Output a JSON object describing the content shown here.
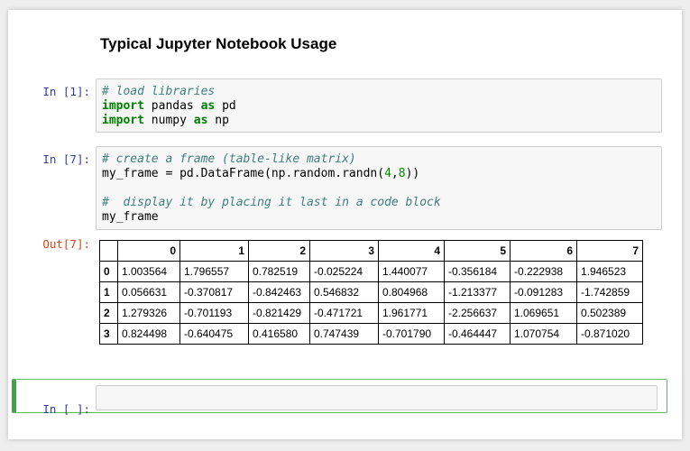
{
  "notebook": {
    "title": "Typical Jupyter Notebook Usage",
    "cells": [
      {
        "prompt": "In [1]:",
        "lines": [
          {
            "comment": "# load libraries"
          },
          {
            "kw1": "import",
            "mid": " pandas ",
            "kw2": "as",
            "end": " pd"
          },
          {
            "kw1": "import",
            "mid": " numpy ",
            "kw2": "as",
            "end": " np"
          }
        ]
      },
      {
        "prompt": "In [7]:",
        "line1_comment": "# create a frame (table-like matrix)",
        "line2_pre": "my_frame = pd.DataFrame(np.random.randn(",
        "line2_n1": "4",
        "line2_sep": ",",
        "line2_n2": "8",
        "line2_post": "))",
        "line4_comment": "#  display it by placing it last in a code block",
        "line5": "my_frame"
      }
    ],
    "output_prompt": "Out[7]:",
    "empty_prompt": "In [ ]:"
  },
  "dataframe": {
    "columns": [
      "",
      "0",
      "1",
      "2",
      "3",
      "4",
      "5",
      "6",
      "7"
    ],
    "rows": [
      {
        "index": "0",
        "values": [
          "1.003564",
          "1.796557",
          "0.782519",
          "-0.025224",
          "1.440077",
          "-0.356184",
          "-0.222938",
          "1.946523"
        ]
      },
      {
        "index": "1",
        "values": [
          "0.056631",
          "-0.370817",
          "-0.842463",
          "0.546832",
          "0.804968",
          "-1.213377",
          "-0.091283",
          "-1.742859"
        ]
      },
      {
        "index": "2",
        "values": [
          "1.279326",
          "-0.701193",
          "-0.821429",
          "-0.471721",
          "1.961771",
          "-2.256637",
          "1.069651",
          "0.502389"
        ]
      },
      {
        "index": "3",
        "values": [
          "0.824498",
          "-0.640475",
          "0.416580",
          "0.747439",
          "-0.701790",
          "-0.464447",
          "1.070754",
          "-0.871020"
        ]
      }
    ]
  },
  "colors": {
    "in_prompt": "#303f9f",
    "out_prompt": "#d84315",
    "active_border": "#43a047",
    "keyword": "#008000",
    "comment": "#408080"
  }
}
